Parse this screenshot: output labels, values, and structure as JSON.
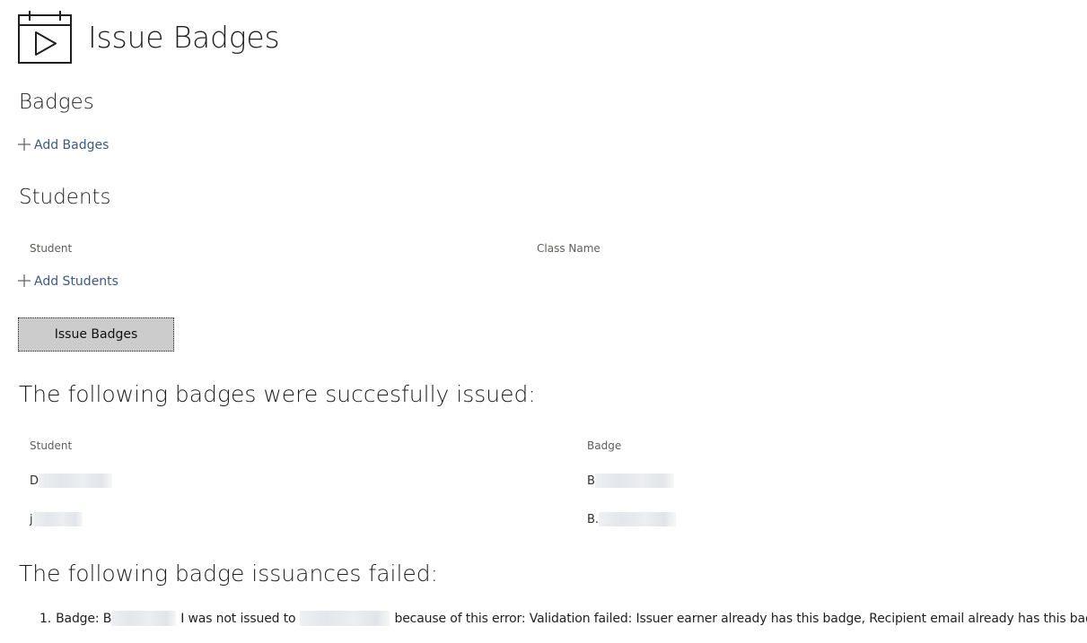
{
  "page": {
    "title": "Issue Badges",
    "icon": "calendar-play-icon"
  },
  "badges_section": {
    "title": "Badges",
    "add_label": "Add Badges"
  },
  "students_section": {
    "title": "Students",
    "columns": {
      "student": "Student",
      "class_name": "Class Name"
    },
    "add_label": "Add Students"
  },
  "issue_button": {
    "label": "Issue Badges"
  },
  "success_section": {
    "title": "The following badges were succesfully issued:",
    "columns": {
      "student": "Student",
      "badge": "Badge"
    },
    "rows": [
      {
        "student": "D",
        "badge": "B"
      },
      {
        "student": "j",
        "badge": "B."
      }
    ]
  },
  "failed_section": {
    "title": "The following badge issuances failed:",
    "items": [
      {
        "number": "1.",
        "prefix": "Badge: B",
        "middle": "I was not issued to",
        "suffix": "because of this error: Validation failed: Issuer earner already has this badge, Recipient email already has this badge"
      }
    ]
  },
  "colors": {
    "link": "#3b5a84",
    "button_bg": "#cccccc",
    "text": "#323130"
  }
}
